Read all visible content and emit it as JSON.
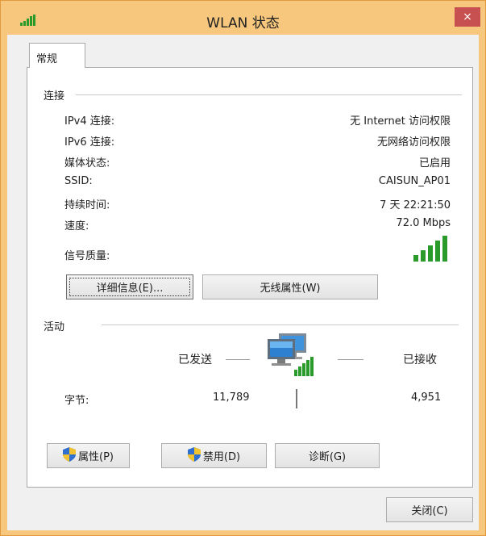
{
  "window": {
    "title": "WLAN 状态",
    "close_glyph": "×",
    "title_icon": "signal-bars-icon",
    "titlebar_color": "#f7c77d",
    "close_color": "#c75050"
  },
  "tabs": [
    {
      "label": "常规",
      "selected": true
    }
  ],
  "connection": {
    "group_label": "连接",
    "rows": [
      {
        "label": "IPv4 连接:",
        "value": "无 Internet 访问权限"
      },
      {
        "label": "IPv6 连接:",
        "value": "无网络访问权限"
      },
      {
        "label": "媒体状态:",
        "value": "已启用"
      },
      {
        "label": "SSID:",
        "value": "CAISUN_AP01"
      },
      {
        "label": "持续时间:",
        "value": "7 天 22:21:50"
      },
      {
        "label": "速度:",
        "value": "72.0 Mbps"
      }
    ],
    "signal_label": "信号质量:",
    "signal_bars": 5,
    "signal_max": 5,
    "signal_color": "#2a9a2a",
    "details_button": "详细信息(E)...",
    "wireless_props_button": "无线属性(W)"
  },
  "activity": {
    "group_label": "活动",
    "sent_label": "已发送",
    "received_label": "已接收",
    "bytes_label": "字节:",
    "sent_bytes": "11,789",
    "received_bytes": "4,951",
    "network_icon": "network-computers-icon"
  },
  "buttons": {
    "properties": "属性(P)",
    "disable": "禁用(D)",
    "diagnose": "诊断(G)",
    "close": "关闭(C)"
  }
}
